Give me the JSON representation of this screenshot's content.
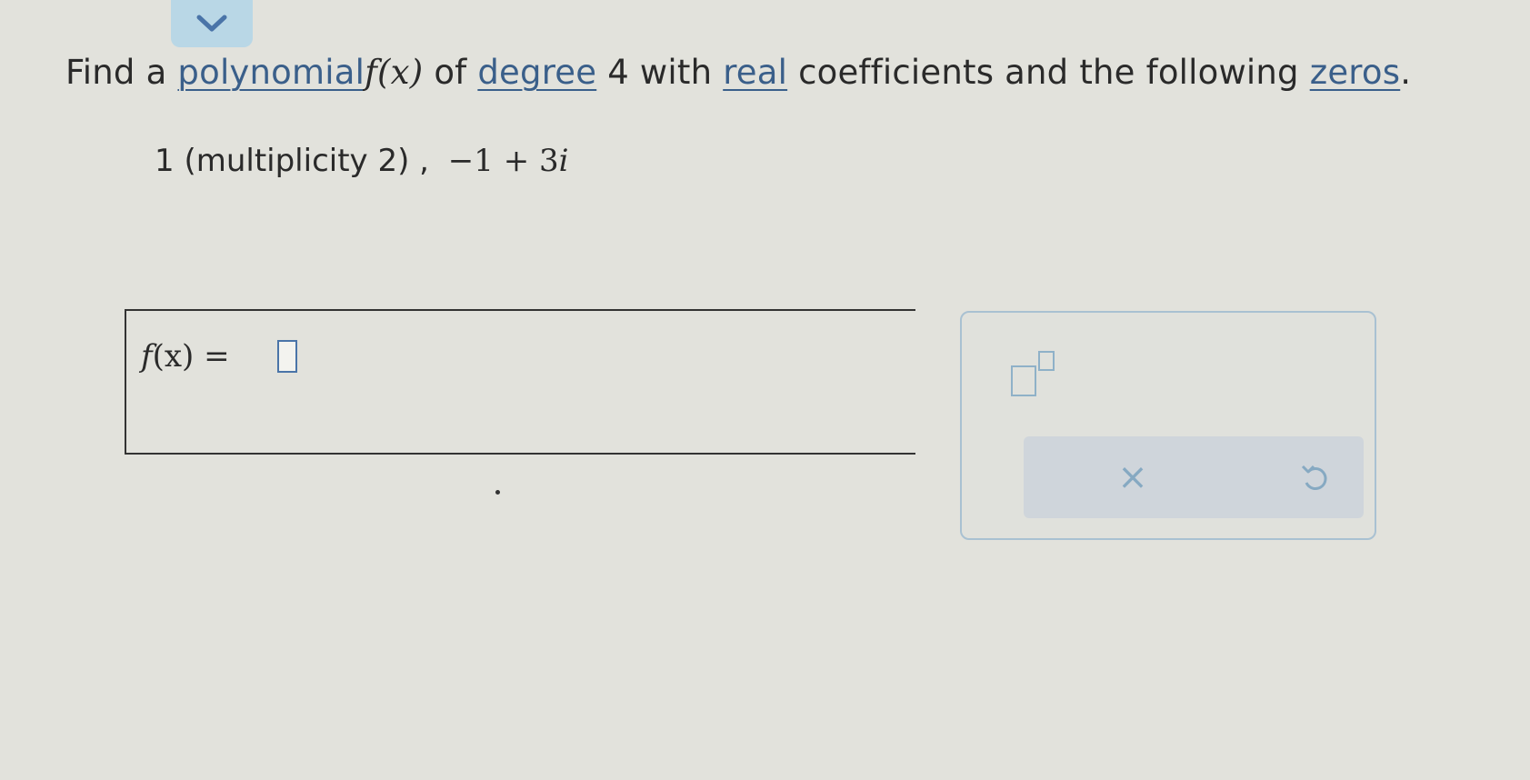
{
  "nav": {
    "collapse_icon": "chevron-down-icon"
  },
  "question": {
    "w_find": "Find a",
    "w_polynomial": "polynomial",
    "func_f": "f",
    "func_args": "(x)",
    "w_of": "of",
    "w_degree": "degree",
    "w_degree_value": "4",
    "w_with": "with",
    "w_real": "real",
    "w_coefficients": "coefficients and the following",
    "w_zeros": "zeros",
    "period": "."
  },
  "zeros": {
    "first": "1 (multiplicity 2) ,",
    "second_re": "−1 + 3",
    "second_im": "i"
  },
  "answer": {
    "label_f": "f",
    "label_rest": "(x) =",
    "value": ""
  },
  "toolbox": {
    "exponent_icon": "exponent-template-icon",
    "clear_label": "×",
    "clear_icon": "clear-icon",
    "undo_icon": "undo-icon"
  },
  "colors": {
    "link": "#3a5f8a",
    "accent": "#4a74a8",
    "toolbox_border": "#a9c1d2",
    "collapse_tab": "#b9d7e6"
  }
}
